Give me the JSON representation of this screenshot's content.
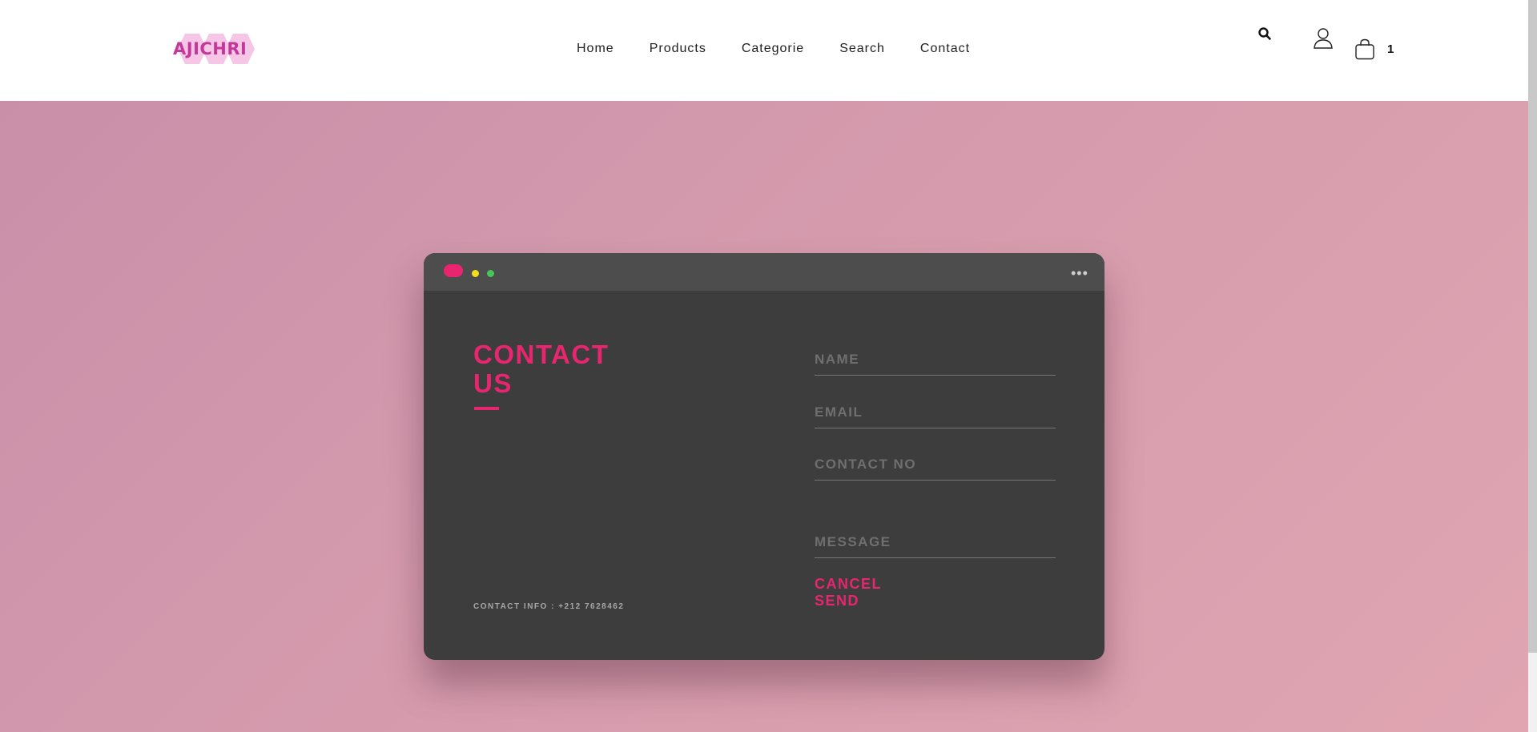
{
  "brand": {
    "logo_text": "AJICHRI",
    "logo_color": "#c2399a"
  },
  "nav": [
    "Home",
    "Products",
    "Categorie",
    "Search",
    "Contact"
  ],
  "header_icons": [
    "search-icon",
    "user-icon",
    "shopping-bag-icon"
  ],
  "cart": {
    "count": "1"
  },
  "contact_card": {
    "title_line1": "CONTACT",
    "title_line2": "US",
    "contact_info": "CONTACT INFO : +212 7628462",
    "fields": {
      "name_placeholder": "NAME",
      "email_placeholder": "EMAIL",
      "contact_no_placeholder": "CONTACT NO",
      "message_placeholder": "MESSAGE"
    },
    "buttons": {
      "cancel": "CANCEL",
      "send": "SEND"
    },
    "accent_color": "#e8256f"
  },
  "colors": {
    "background_gradient_start": "#c98fa9",
    "background_gradient_end": "#e0a5b1",
    "card": "#3d3d3d",
    "card_titlebar": "#4d4d4e"
  }
}
